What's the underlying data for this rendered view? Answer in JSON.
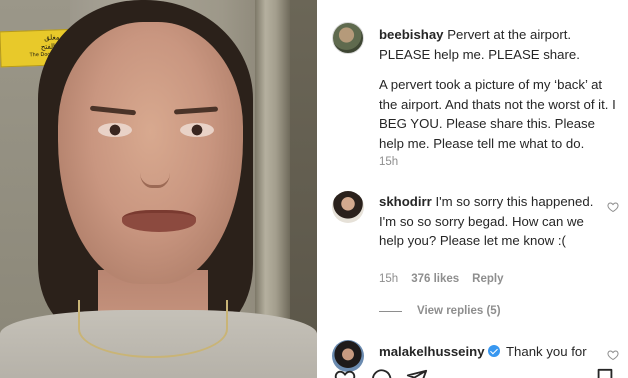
{
  "post": {
    "username": "beebishay",
    "caption_title": "Pervert at the airport. PLEASE help me. PLEASE share.",
    "caption_body": "A pervert took a picture of my ‘back’ at the airport. And thats not the worst of it. I BEG YOU. Please share this. Please help me. Please tell me what to do.",
    "time": "15h"
  },
  "media": {
    "sign_lines": [
      "الباب مغلق",
      "محاوله الفتح",
      "The Door Is Locked"
    ]
  },
  "comments": [
    {
      "username": "skhodirr",
      "text": "I'm so sorry this happened. I'm so so sorry begad. How can we help you? Please let me know :(",
      "time": "15h",
      "likes": "376 likes",
      "reply_label": "Reply",
      "view_replies": "View replies (5)"
    },
    {
      "username": "malakelhusseiny",
      "text": "Thank you for",
      "verified": true
    }
  ],
  "icons": {
    "heart": "heart-icon",
    "comment": "comment-icon",
    "share": "share-icon",
    "save": "bookmark-icon"
  },
  "colors": {
    "text": "#262626",
    "muted": "#8e8e8e",
    "verified": "#3897f0"
  }
}
